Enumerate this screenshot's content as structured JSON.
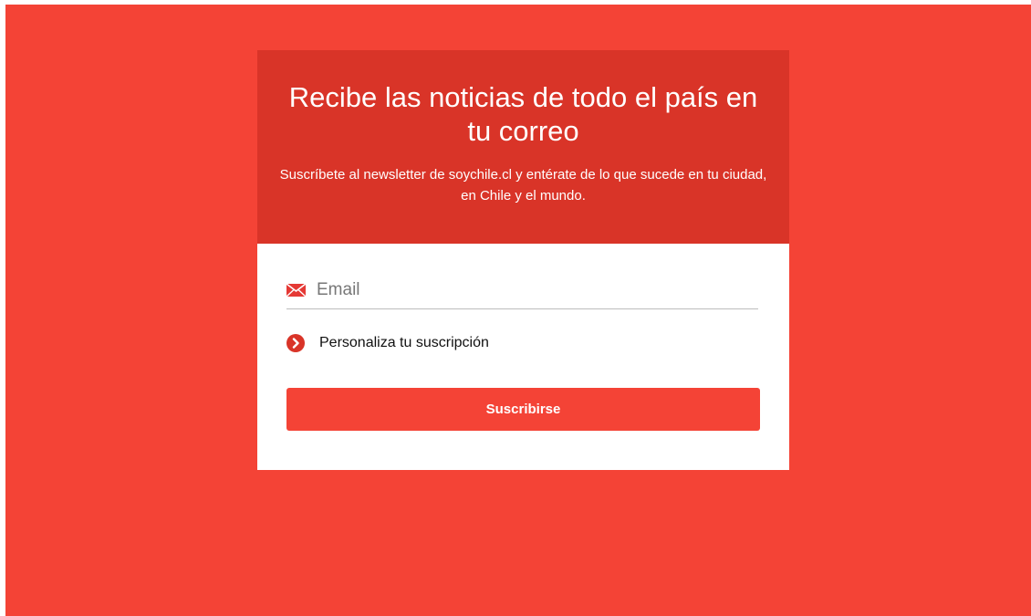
{
  "colors": {
    "page_background": "#f44336",
    "header_background": "#d93428",
    "accent": "#f44336",
    "card_background": "#ffffff"
  },
  "header": {
    "title": "Recibe las noticias de todo el país en tu correo",
    "subtitle": "Suscríbete al newsletter de soychile.cl y entérate de lo que sucede en tu ciudad, en Chile y el mundo."
  },
  "form": {
    "email": {
      "icon": "mail-icon",
      "placeholder": "Email",
      "value": ""
    },
    "personalize": {
      "icon": "chevron-right-circle-icon",
      "label": "Personaliza tu suscripción"
    },
    "submit_label": "Suscribirse"
  }
}
